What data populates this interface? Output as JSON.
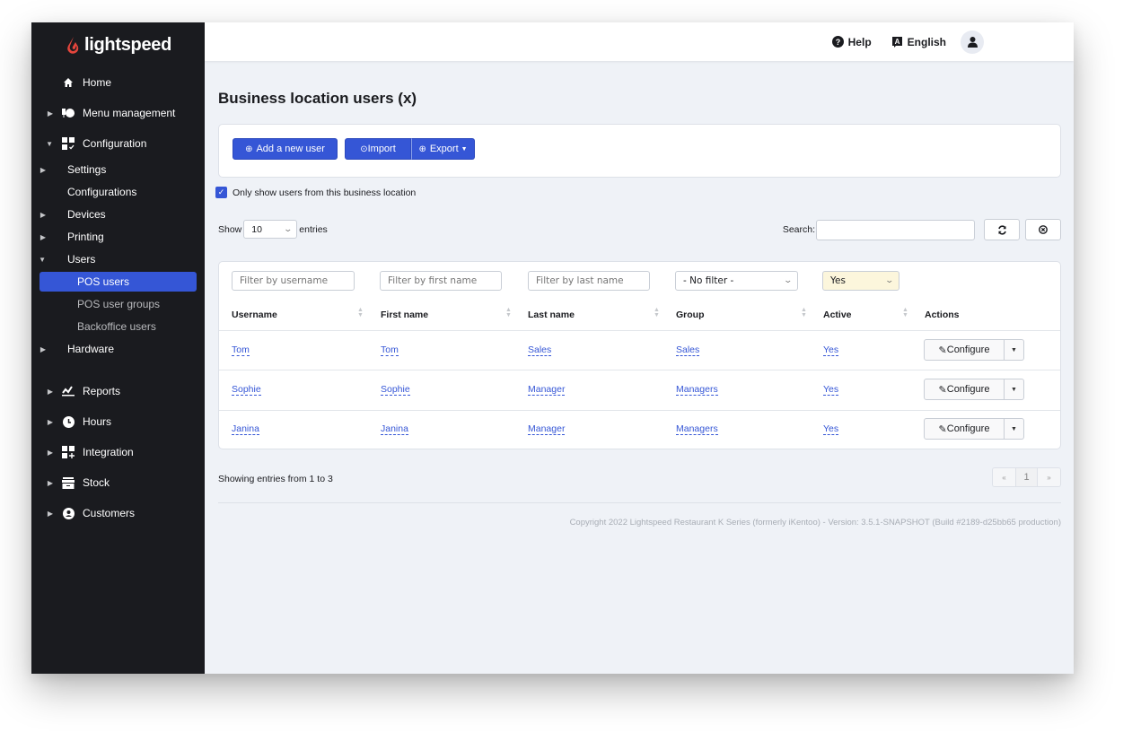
{
  "brand": {
    "name": "lightspeed",
    "accent": "#3556d6",
    "logo_color": "#e4453c"
  },
  "sidebar": {
    "items": [
      {
        "label": "Home",
        "icon": "home-icon",
        "caret": ""
      },
      {
        "label": "Menu management",
        "icon": "menu-management-icon",
        "caret": "right"
      },
      {
        "label": "Configuration",
        "icon": "configuration-icon",
        "caret": "down"
      },
      {
        "label": "Settings",
        "caret": "right"
      },
      {
        "label": "Configurations",
        "caret": ""
      },
      {
        "label": "Devices",
        "caret": "right"
      },
      {
        "label": "Printing",
        "caret": "right"
      },
      {
        "label": "Users",
        "caret": "down"
      },
      {
        "label": "POS users",
        "active": true
      },
      {
        "label": "POS user groups"
      },
      {
        "label": "Backoffice users"
      },
      {
        "label": "Hardware",
        "caret": "right"
      },
      {
        "label": "Reports",
        "icon": "reports-icon",
        "caret": "right"
      },
      {
        "label": "Hours",
        "icon": "clock-icon",
        "caret": "right"
      },
      {
        "label": "Integration",
        "icon": "integration-icon",
        "caret": "right"
      },
      {
        "label": "Stock",
        "icon": "stock-icon",
        "caret": "right"
      },
      {
        "label": "Customers",
        "icon": "customer-icon",
        "caret": "right"
      }
    ]
  },
  "topbar": {
    "help": "Help",
    "language": "English"
  },
  "page": {
    "title": "Business location users (x)",
    "toolbar": {
      "add_user": "Add a new user",
      "import": "Import",
      "export": "Export"
    },
    "only_location_label": "Only show users from this business location",
    "only_location_checked": true,
    "show_label": "Show",
    "entries_label": "entries",
    "page_size": "10",
    "search_label": "Search:",
    "search_value": ""
  },
  "table": {
    "filters": {
      "username_placeholder": "Filter by username",
      "first_name_placeholder": "Filter by first name",
      "last_name_placeholder": "Filter by last name",
      "group_value": "- No filter -",
      "active_value": "Yes"
    },
    "columns": [
      "Username",
      "First name",
      "Last name",
      "Group",
      "Active",
      "Actions"
    ],
    "rows": [
      {
        "username": "Tom",
        "first_name": "Tom",
        "last_name": "Sales",
        "group": "Sales",
        "active": "Yes",
        "action": "Configure"
      },
      {
        "username": "Sophie",
        "first_name": "Sophie",
        "last_name": "Manager",
        "group": "Managers",
        "active": "Yes",
        "action": "Configure"
      },
      {
        "username": "Janina",
        "first_name": "Janina",
        "last_name": "Manager",
        "group": "Managers",
        "active": "Yes",
        "action": "Configure"
      }
    ]
  },
  "pagination": {
    "summary": "Showing entries from 1 to 3",
    "prev": "«",
    "current": "1",
    "next": "»"
  },
  "footer": {
    "text": "Copyright 2022 Lightspeed Restaurant K Series (formerly iKentoo) - Version: 3.5.1-SNAPSHOT (Build #2189-d25bb65 production)"
  }
}
